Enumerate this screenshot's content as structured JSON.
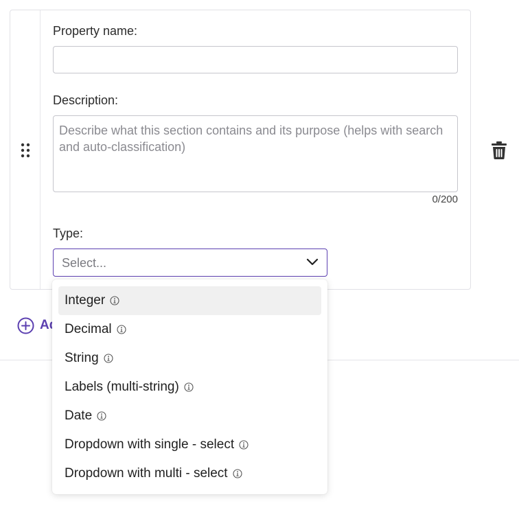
{
  "form": {
    "property_name_label": "Property name:",
    "property_name_value": "",
    "description_label": "Description:",
    "description_placeholder": "Describe what this section contains and its purpose (helps with search and auto-classification)",
    "description_counter": "0/200",
    "type_label": "Type:",
    "type_placeholder": "Select..."
  },
  "add_button": {
    "label": "Add"
  },
  "type_menu": {
    "items": [
      {
        "label": "Integer",
        "highlighted": true
      },
      {
        "label": "Decimal"
      },
      {
        "label": "String"
      },
      {
        "label": "Labels (multi-string)"
      },
      {
        "label": "Date"
      },
      {
        "label": "Dropdown with single - select"
      },
      {
        "label": "Dropdown with multi - select"
      }
    ]
  },
  "icons": {
    "drag": "drag-handle-icon",
    "trash": "trash-icon",
    "chevron": "chevron-down-icon",
    "add": "plus-circle-icon",
    "info": "info-icon"
  },
  "colors": {
    "accent": "#5b3fb0",
    "highlight": "#f0f0f0",
    "border": "#c5c5cc"
  }
}
